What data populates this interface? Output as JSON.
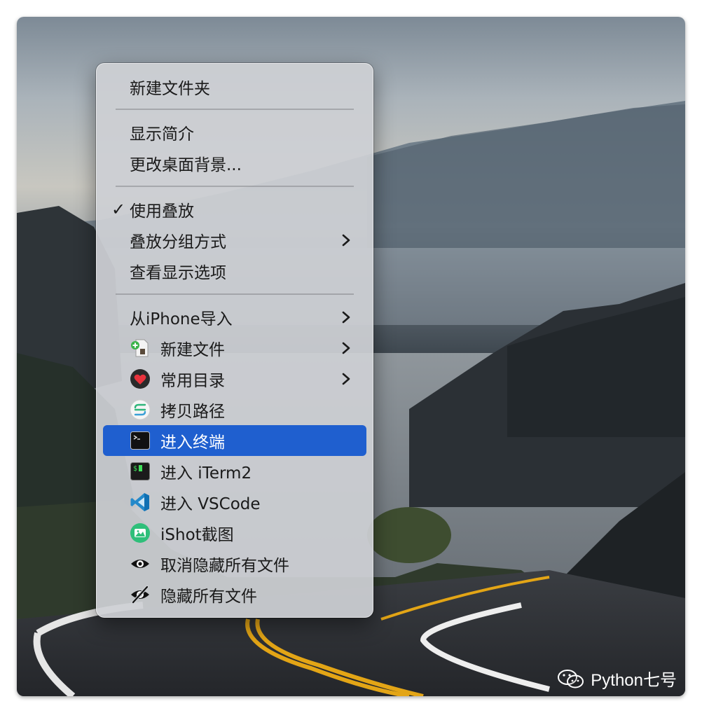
{
  "menu": {
    "new_folder": "新建文件夹",
    "get_info": "显示简介",
    "change_bg": "更改桌面背景...",
    "use_stacks": "使用叠放",
    "use_stacks_checked": "✓",
    "group_stacks": "叠放分组方式",
    "view_options": "查看显示选项",
    "import_iphone": "从iPhone导入",
    "new_file": "新建文件",
    "common_dirs": "常用目录",
    "copy_path": "拷贝路径",
    "open_terminal": "进入终端",
    "open_iterm": "进入 iTerm2",
    "open_vscode": "进入 VSCode",
    "ishot": "iShot截图",
    "unhide_all": "取消隐藏所有文件",
    "hide_all": "隐藏所有文件"
  },
  "icons": {
    "chevron": "chevron-right-icon",
    "check": "checkmark-icon",
    "new_file": "new-file-icon",
    "common_dirs": "heart-icon",
    "copy_path": "copy-path-icon",
    "open_terminal": "terminal-icon",
    "open_iterm": "iterm-icon",
    "open_vscode": "vscode-icon",
    "ishot": "ishot-icon",
    "unhide_all": "eye-icon",
    "hide_all": "eye-slash-icon"
  },
  "watermark": {
    "text": "Python七号"
  },
  "colors": {
    "highlight": "#1f5fcf",
    "menu_bg": "#cdd0d4"
  }
}
